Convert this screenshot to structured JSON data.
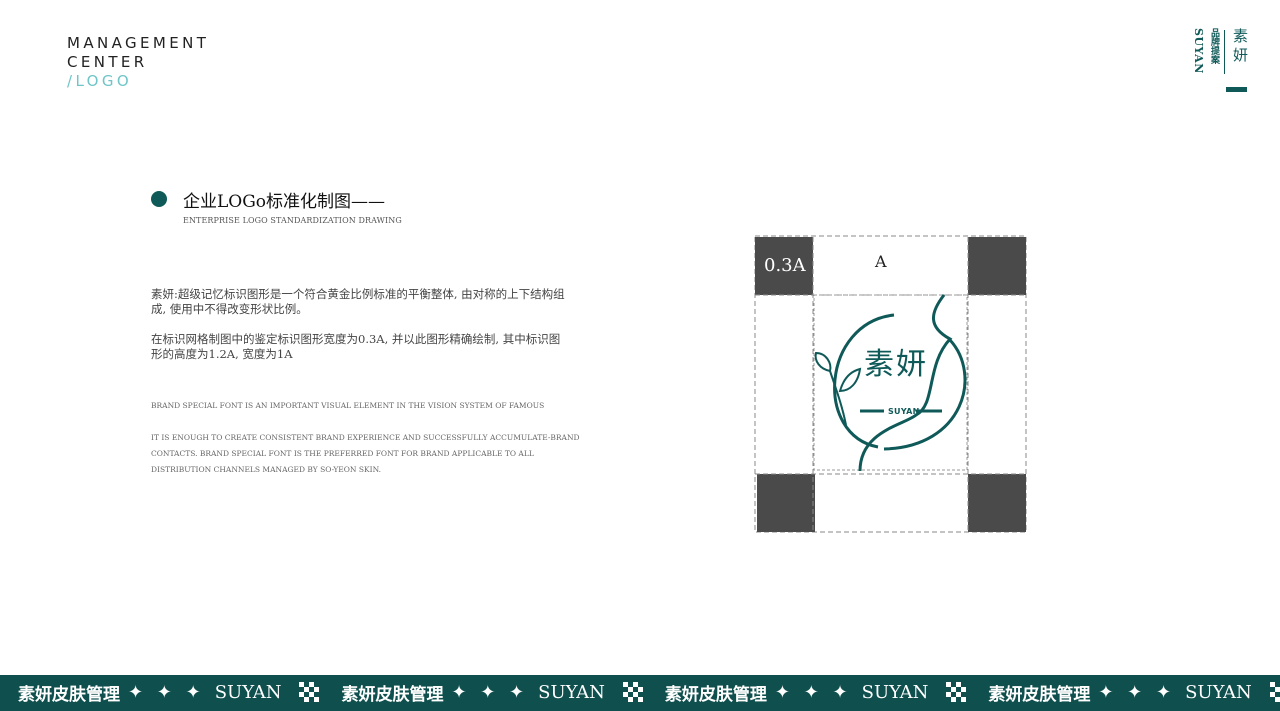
{
  "header": {
    "line1": "MANAGEMENT",
    "line2": "CENTER",
    "line3": "/LOGO"
  },
  "brand_mark": {
    "en": "SUYAN",
    "cn_small": "品牌提案",
    "cn_big": "素妍"
  },
  "section": {
    "title": "企业LOGo标准化制图——",
    "subtitle": "ENTERPRISE LOGO STANDARDIZATION DRAWING"
  },
  "body": {
    "p1": "素妍:超级记忆标识图形是一个符合黄金比例标准的平衡整体, 由对称的上下结构组成, 使用中不得改变形状比例。",
    "p2": "在标识网格制图中的鉴定标识图形宽度为0.3A, 并以此图形精确绘制, 其中标识图形的高度为1.2A, 宽度为1A",
    "en1": "BRAND SPECIAL FONT IS AN IMPORTANT VISUAL ELEMENT IN THE VISION SYSTEM OF FAMOUS",
    "en2": "IT IS ENOUGH TO CREATE CONSISTENT BRAND EXPERIENCE AND SUCCESSFULLY ACCUMULATE-BRAND CONTACTS. BRAND SPECIAL FONT IS THE PREFERRED FONT FOR BRAND APPLICABLE TO ALL DISTRIBUTION CHANNELS MANAGED BY SO-YEON SKIN."
  },
  "diagram": {
    "label_03a": "0.3A",
    "label_a": "A",
    "logo_cn": "素妍",
    "logo_en": "SUYAN",
    "square_color": "#4a4a4a",
    "logo_color": "#0f5a59"
  },
  "footer": {
    "items": [
      {
        "cn": "素妍皮肤管理",
        "stars": "✦ ✦ ✦",
        "en": "SUYAN"
      },
      {
        "cn": "素妍皮肤管理",
        "stars": "✦ ✦ ✦",
        "en": "SUYAN"
      },
      {
        "cn": "素妍皮肤管理",
        "stars": "✦ ✦ ✦",
        "en": "SUYAN"
      },
      {
        "cn": "素妍皮肤管理",
        "stars": "✦ ✦ ✦",
        "en": "SUYAN"
      }
    ],
    "color": "#0f4f4e"
  }
}
